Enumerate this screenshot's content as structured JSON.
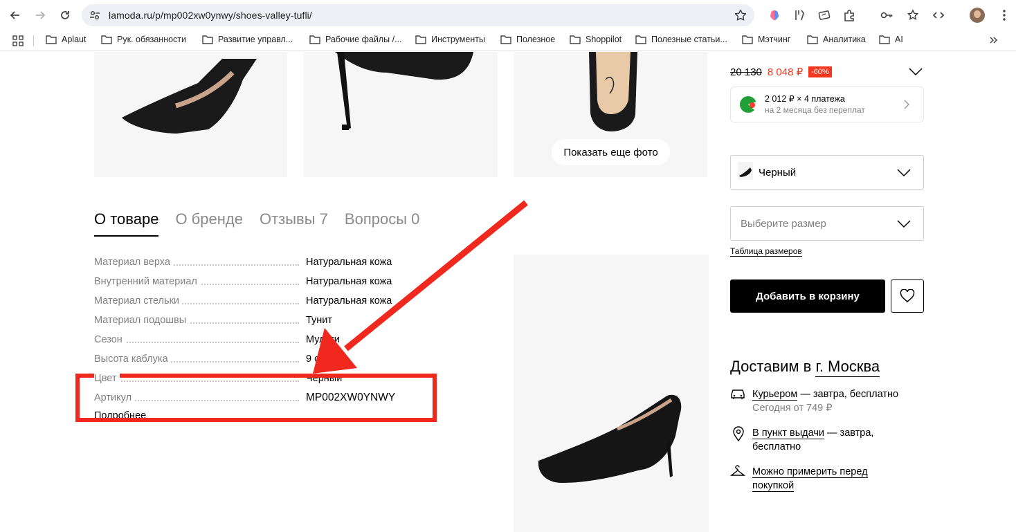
{
  "browser": {
    "url": "lamoda.ru/p/mp002xw0ynwy/shoes-valley-tufli/",
    "bookmarks": [
      "Aplaut",
      "Рук. обязанности",
      "Развитие управл...",
      "Рабочие файлы /...",
      "Инструменты",
      "Полезное",
      "Shoppilot",
      "Полезные статьи...",
      "Мэтчинг",
      "Аналитика",
      "AI"
    ]
  },
  "gallery": {
    "show_more": "Показать еще фото"
  },
  "tabs": [
    {
      "label": "О товаре",
      "active": true
    },
    {
      "label": "О бренде",
      "active": false
    },
    {
      "label": "Отзывы 7",
      "active": false
    },
    {
      "label": "Вопросы 0",
      "active": false
    }
  ],
  "attributes": [
    {
      "key": "Материал верха",
      "value": "Натуральная кожа"
    },
    {
      "key": "Внутренний материал",
      "value": "Натуральная кожа"
    },
    {
      "key": "Материал стельки",
      "value": "Натуральная кожа"
    },
    {
      "key": "Материал подошвы",
      "value": "Тунит"
    },
    {
      "key": "Сезон",
      "value": "Мульти"
    },
    {
      "key": "Высота каблука",
      "value": "9 с"
    },
    {
      "key": "Цвет",
      "value": "Черный"
    },
    {
      "key": "Артикул",
      "value": "MP002XW0YNWY"
    }
  ],
  "more_link": "Подробнее",
  "price": {
    "old": "20 130",
    "new": "8 048 ₽",
    "discount": "-60%"
  },
  "split_payment": {
    "line1": "2 012 ₽ × 4 платежа",
    "line2": "на 2 месяца без переплат"
  },
  "color_select": "Черный",
  "size_select_placeholder": "Выберите размер",
  "size_table_link": "Таблица размеров",
  "add_to_cart": "Добавить в корзину",
  "delivery": {
    "title_prefix": "Доставим в",
    "city": "г. Москва",
    "courier_link": "Курьером",
    "courier_rest": " — завтра, бесплатно",
    "courier_sub": "Сегодня от 749 ₽",
    "pickup_link": "В пункт выдачи",
    "pickup_rest": " — завтра, бесплатно",
    "tryon_link": "Можно примерить перед покупкой"
  },
  "colors": {
    "accent_red": "#f5361e",
    "annotation_red": "#f0281d"
  }
}
